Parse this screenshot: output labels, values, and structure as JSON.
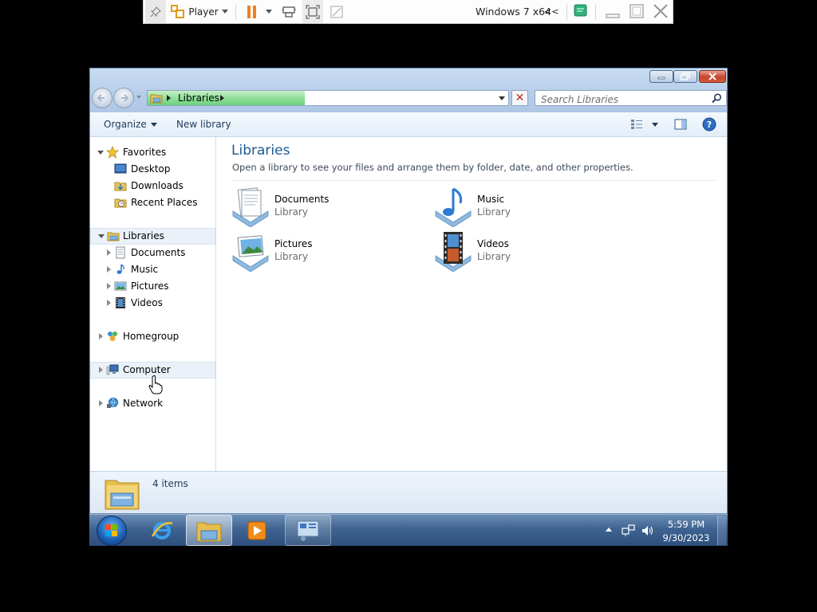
{
  "vm_toolbar": {
    "player_label": "Player",
    "vm_name": "Windows 7 x64",
    "collapse_glyph": "<<",
    "icons": [
      "pin-icon",
      "player-menu-icon",
      "pause-icon",
      "send-ctrl-alt-del-icon",
      "fullscreen-icon",
      "unity-icon",
      "notes-icon",
      "minimize-icon",
      "maximize-icon",
      "close-icon"
    ],
    "pause_color": "#f08020"
  },
  "explorer": {
    "address": {
      "crumb": "Libraries"
    },
    "search": {
      "placeholder": "Search Libraries"
    },
    "command_bar": {
      "organize_label": "Organize",
      "new_library_label": "New library"
    },
    "nav_pane": {
      "favorites": {
        "label": "Favorites",
        "items": [
          {
            "label": "Desktop"
          },
          {
            "label": "Downloads"
          },
          {
            "label": "Recent Places"
          }
        ]
      },
      "libraries": {
        "label": "Libraries",
        "items": [
          {
            "label": "Documents"
          },
          {
            "label": "Music"
          },
          {
            "label": "Pictures"
          },
          {
            "label": "Videos"
          }
        ]
      },
      "homegroup_label": "Homegroup",
      "computer_label": "Computer",
      "network_label": "Network"
    },
    "content": {
      "title": "Libraries",
      "subtitle": "Open a library to see your files and arrange them by folder, date, and other properties.",
      "libraries": [
        {
          "name": "Documents",
          "type": "Library",
          "icon": "documents-library-icon"
        },
        {
          "name": "Music",
          "type": "Library",
          "icon": "music-library-icon"
        },
        {
          "name": "Pictures",
          "type": "Library",
          "icon": "pictures-library-icon"
        },
        {
          "name": "Videos",
          "type": "Library",
          "icon": "videos-library-icon"
        }
      ]
    },
    "details": {
      "item_count": "4 items"
    },
    "accent_title_color": "#1e5a91"
  },
  "taskbar": {
    "clock_time": "5:59 PM",
    "clock_date": "9/30/2023",
    "buttons": [
      "internet-explorer-icon",
      "windows-explorer-icon",
      "media-player-icon",
      "remote-desktop-icon"
    ]
  }
}
